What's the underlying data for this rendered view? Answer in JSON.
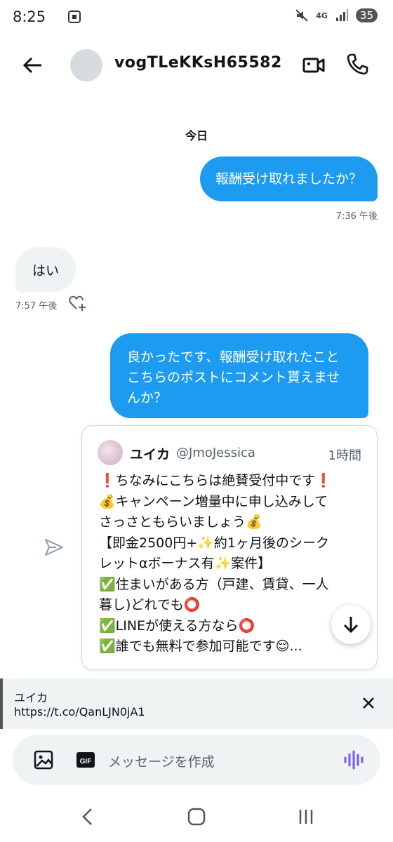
{
  "status_bar": {
    "time": "8:25",
    "network": "4G",
    "battery": "35"
  },
  "header": {
    "username": "vogTLeKKsH65582"
  },
  "chat": {
    "date_label": "今日",
    "messages": [
      {
        "direction": "out",
        "text": "報酬受け取れましたか？",
        "time": "7:36 午後"
      },
      {
        "direction": "in",
        "text": "はい",
        "time": "7:57 午後"
      },
      {
        "direction": "out",
        "lines": [
          "良かったです、報酬受け取れたこと",
          "こちらのポストにコメント貰えませ",
          "んか？"
        ]
      }
    ]
  },
  "shared_post": {
    "author_name": "ユイカ",
    "author_handle": "@JmoJessica",
    "time": "1時間",
    "lines": [
      "❗ちなみにこちらは絶賛受付中です❗",
      "💰キャンペーン増量中に申し込みして",
      "さっさともらいましょう💰",
      "【即金2500円+✨約1ヶ月後のシーク",
      "レットαボーナス有✨案件】",
      "✅住まいがある方（戸建、賃貸、一人",
      "暮し)どれでも⭕",
      "✅LINEが使える方なら⭕",
      "✅誰でも無料で参加可能です😌..."
    ]
  },
  "link_preview": {
    "title": "ユイカ",
    "url": "https://t.co/QanLJN0jA1"
  },
  "composer": {
    "placeholder": "メッセージを作成"
  },
  "colors": {
    "accent": "#1d9bf0",
    "bubble_in": "#eff3f4",
    "mic": "#7856ff"
  }
}
